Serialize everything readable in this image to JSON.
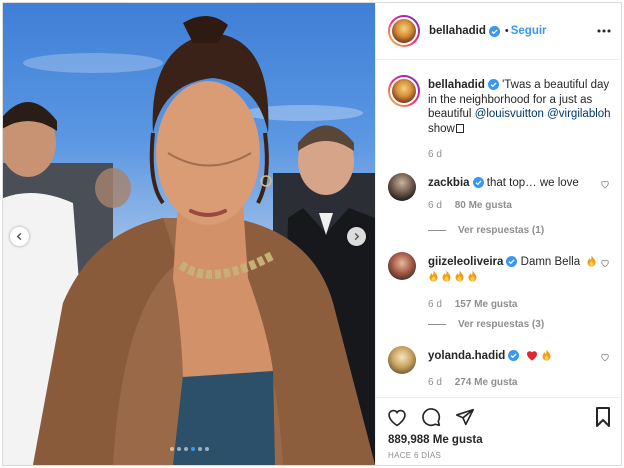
{
  "post": {
    "username": "bellahadid",
    "follow_label": "Seguir",
    "separator": "•"
  },
  "caption": {
    "username": "bellahadid",
    "text_before": "'Twas a beautiful day in the neighborhood for a just as beautiful ",
    "mention1": "@louisvuitton",
    "mention2": "@virgilabloh",
    "text_after": "show",
    "time": "6 d"
  },
  "comments": [
    {
      "username": "zackbia",
      "text": "that top… we love",
      "time": "6 d",
      "likes": "80 Me gusta",
      "replies": "Ver respuestas (1)"
    },
    {
      "username": "giizeleoliveira",
      "text": "Damn Bella",
      "time": "6 d",
      "likes": "157 Me gusta",
      "replies": "Ver respuestas (3)"
    },
    {
      "username": "yolanda.hadid",
      "text": "",
      "time": "6 d",
      "likes": "274 Me gusta"
    }
  ],
  "footer": {
    "likes_total": "889,988 Me gusta",
    "time_ago": "HACE 6 DÍAS"
  },
  "carousel": {
    "count": 6,
    "active_index": 3
  },
  "colors": {
    "accent": "#3897f0",
    "verified": "#3897f0",
    "muted": "#8e8e8e",
    "heart_red": "#ed4956"
  },
  "icons": [
    "verified-icon",
    "more-options-icon",
    "heart-icon",
    "comment-icon",
    "share-icon",
    "bookmark-icon",
    "chevron-left-icon",
    "chevron-right-icon",
    "fire-emoji",
    "red-heart-emoji"
  ]
}
